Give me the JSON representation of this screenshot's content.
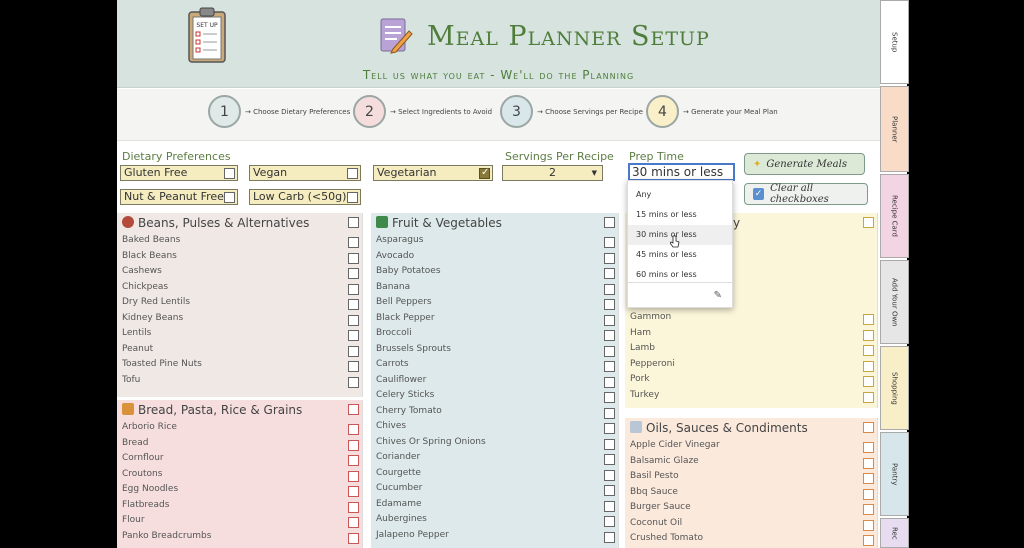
{
  "header": {
    "title": "Meal Planner Setup",
    "subtitle": "Tell us what you eat - We'll do the Planning",
    "clipboard_label": "SET UP"
  },
  "steps": [
    {
      "num": "1",
      "text": "→ Choose Dietary Preferences"
    },
    {
      "num": "2",
      "text": "→ Select Ingredients to Avoid"
    },
    {
      "num": "3",
      "text": "→ Choose Servings per Recipe"
    },
    {
      "num": "4",
      "text": "→ Generate your Meal Plan"
    }
  ],
  "dietary": {
    "label": "Dietary Preferences",
    "options": [
      {
        "label": "Gluten Free",
        "checked": false
      },
      {
        "label": "Vegan",
        "checked": false
      },
      {
        "label": "Vegetarian",
        "checked": true
      },
      {
        "label": "Nut & Peanut Free",
        "checked": false
      },
      {
        "label": "Low Carb (<50g)",
        "checked": false
      }
    ]
  },
  "servings": {
    "label": "Servings Per Recipe",
    "value": "2"
  },
  "prep": {
    "label": "Prep Time",
    "value": "30 mins or less",
    "options": [
      "Any",
      "15 mins or less",
      "30 mins or less",
      "45 mins or less",
      "60 mins or less"
    ],
    "highlighted": "30 mins or less"
  },
  "buttons": {
    "generate": "Generate Meals",
    "clear": "Clear all checkboxes"
  },
  "panels": {
    "beans": {
      "title": "Beans, Pulses & Alternatives",
      "items": [
        "Baked Beans",
        "Black Beans",
        "Cashews",
        "Chickpeas",
        "Dry Red Lentils",
        "Kidney Beans",
        "Lentils",
        "Peanut",
        "Toasted Pine Nuts",
        "Tofu"
      ]
    },
    "bread": {
      "title": "Bread, Pasta, Rice & Grains",
      "items": [
        "Arborio Rice",
        "Bread",
        "Cornflour",
        "Croutons",
        "Egg Noodles",
        "Flatbreads",
        "Flour",
        "Panko Breadcrumbs"
      ]
    },
    "fruit": {
      "title": "Fruit & Vegetables",
      "items": [
        "Asparagus",
        "Avocado",
        "Baby Potatoes",
        "Banana",
        "Bell Peppers",
        "Black Pepper",
        "Broccoli",
        "Brussels Sprouts",
        "Carrots",
        "Cauliflower",
        "Celery Sticks",
        "Cherry Tomato",
        "Chives",
        "Chives Or Spring Onions",
        "Coriander",
        "Courgette",
        "Cucumber",
        "Edamame",
        "Aubergines",
        "Jalapeno Pepper"
      ]
    },
    "meat": {
      "title_tail": "y",
      "items": [
        "Gammon",
        "Ham",
        "Lamb",
        "Pepperoni",
        "Pork",
        "Turkey"
      ]
    },
    "oils": {
      "title": "Oils, Sauces & Condiments",
      "items": [
        "Apple Cider Vinegar",
        "Balsamic Glaze",
        "Basil Pesto",
        "Bbq Sauce",
        "Burger Sauce",
        "Coconut Oil",
        "Crushed Tomato"
      ]
    }
  },
  "side_tabs": [
    "Setup",
    "Planner",
    "Recipe Card",
    "Add Your Own",
    "Shopping",
    "Pantry",
    "Rec"
  ],
  "colors": {
    "header_bg": "#d6e3df",
    "title_green": "#4f7d3a",
    "beans_bg": "#efe8e4",
    "bread_bg": "#f6dede",
    "fruit_bg": "#dde9ea",
    "meat_bg": "#fbf5d9",
    "oils_bg": "#fbe9dc"
  }
}
